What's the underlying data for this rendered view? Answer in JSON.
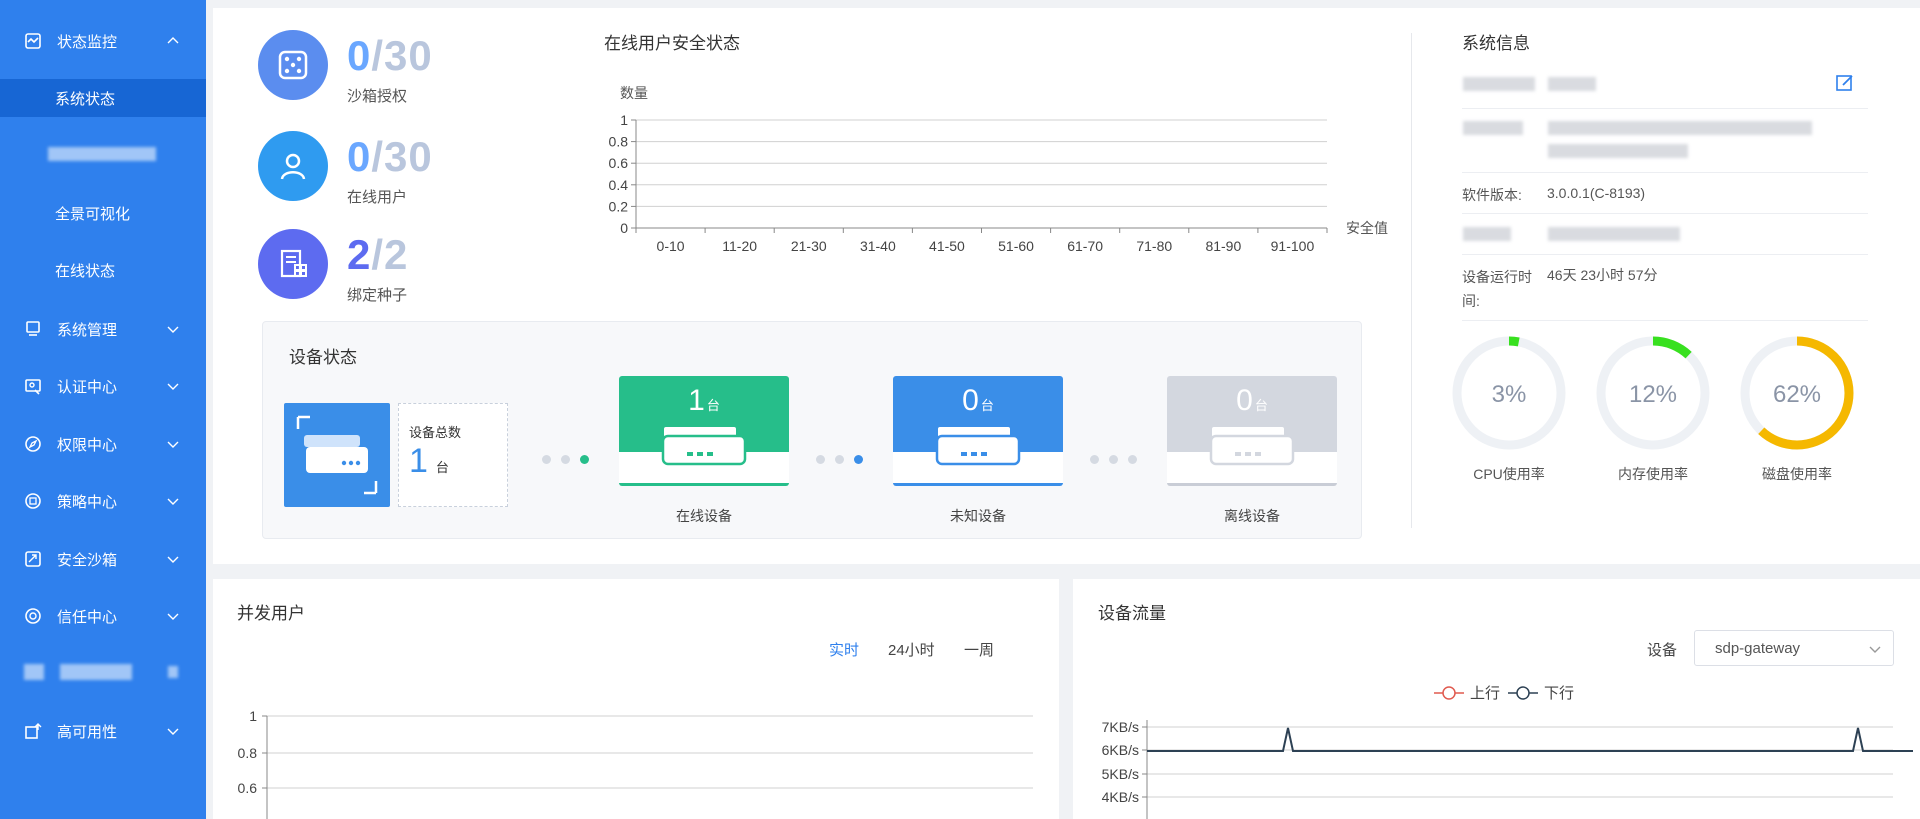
{
  "sidebar": {
    "items": [
      {
        "label": "状态监控",
        "icon": "monitor-icon",
        "expanded": true
      },
      {
        "label": "系统管理",
        "icon": "computer-icon"
      },
      {
        "label": "认证中心",
        "icon": "user-auth-icon"
      },
      {
        "label": "权限中心",
        "icon": "compass-icon"
      },
      {
        "label": "策略中心",
        "icon": "policy-icon"
      },
      {
        "label": "安全沙箱",
        "icon": "sandbox-icon"
      },
      {
        "label": "信任中心",
        "icon": "trust-icon"
      },
      {
        "label": "高可用性",
        "icon": "availability-icon"
      }
    ],
    "sub_items": [
      {
        "label": "系统状态",
        "active": true
      },
      {
        "label": "全景可视化"
      },
      {
        "label": "在线状态"
      }
    ]
  },
  "stats": [
    {
      "value": "0",
      "sep": "/",
      "total": "30",
      "label": "沙箱授权",
      "color": "#5b8def"
    },
    {
      "value": "0",
      "sep": "/",
      "total": "30",
      "label": "在线用户",
      "color": "#2f9bf0"
    },
    {
      "value": "2",
      "sep": "/",
      "total": "2",
      "label": "绑定种子",
      "color": "#5d6bf0"
    }
  ],
  "security_chart": {
    "title": "在线用户安全状态",
    "chart_data": {
      "type": "bar",
      "title": "在线用户安全状态",
      "ylabel": "数量",
      "xlabel": "安全值",
      "categories": [
        "0-10",
        "11-20",
        "21-30",
        "31-40",
        "41-50",
        "51-60",
        "61-70",
        "71-80",
        "81-90",
        "91-100"
      ],
      "values": [
        0,
        0,
        0,
        0,
        0,
        0,
        0,
        0,
        0,
        0
      ],
      "ylim": [
        0,
        1
      ],
      "yticks": [
        "0",
        "0.2",
        "0.4",
        "0.6",
        "0.8",
        "1"
      ],
      "grid": true
    }
  },
  "device_status": {
    "title": "设备状态",
    "total_label": "设备总数",
    "total_value": "1",
    "unit": "台",
    "tiles": [
      {
        "count": "1",
        "caption": "在线设备",
        "color": "#26be8a"
      },
      {
        "count": "0",
        "caption": "未知设备",
        "color": "#3a8ee8"
      },
      {
        "count": "0",
        "caption": "离线设备",
        "color": "#d3d7df"
      }
    ]
  },
  "system_info": {
    "title": "系统信息",
    "software_version_key": "软件版本:",
    "software_version": "3.0.0.1(C-8193)",
    "uptime_key": "设备运行时间:",
    "uptime": "46天 23小时 57分",
    "gauges": [
      {
        "label": "CPU使用率",
        "value": 3,
        "text": "3%",
        "color": "#38e01f"
      },
      {
        "label": "内存使用率",
        "value": 12,
        "text": "12%",
        "color": "#38e01f"
      },
      {
        "label": "磁盘使用率",
        "value": 62,
        "text": "62%",
        "color": "#f5b800"
      }
    ]
  },
  "concurrent_users": {
    "title": "并发用户",
    "tabs": [
      "实时",
      "24小时",
      "一周"
    ],
    "active_tab": 0,
    "chart_data": {
      "type": "line",
      "yticks": [
        "1",
        "0.8",
        "0.6"
      ],
      "series": []
    }
  },
  "device_traffic": {
    "title": "设备流量",
    "device_label": "设备",
    "device_value": "sdp-gateway",
    "chart_data": {
      "type": "line",
      "legend": [
        "上行",
        "下行"
      ],
      "yticks": [
        "7KB/s",
        "6KB/s",
        "5KB/s",
        "4KB/s"
      ],
      "series": [
        {
          "name": "上行",
          "color": "#e05a4f"
        },
        {
          "name": "下行",
          "color": "#2d4154"
        }
      ]
    }
  }
}
